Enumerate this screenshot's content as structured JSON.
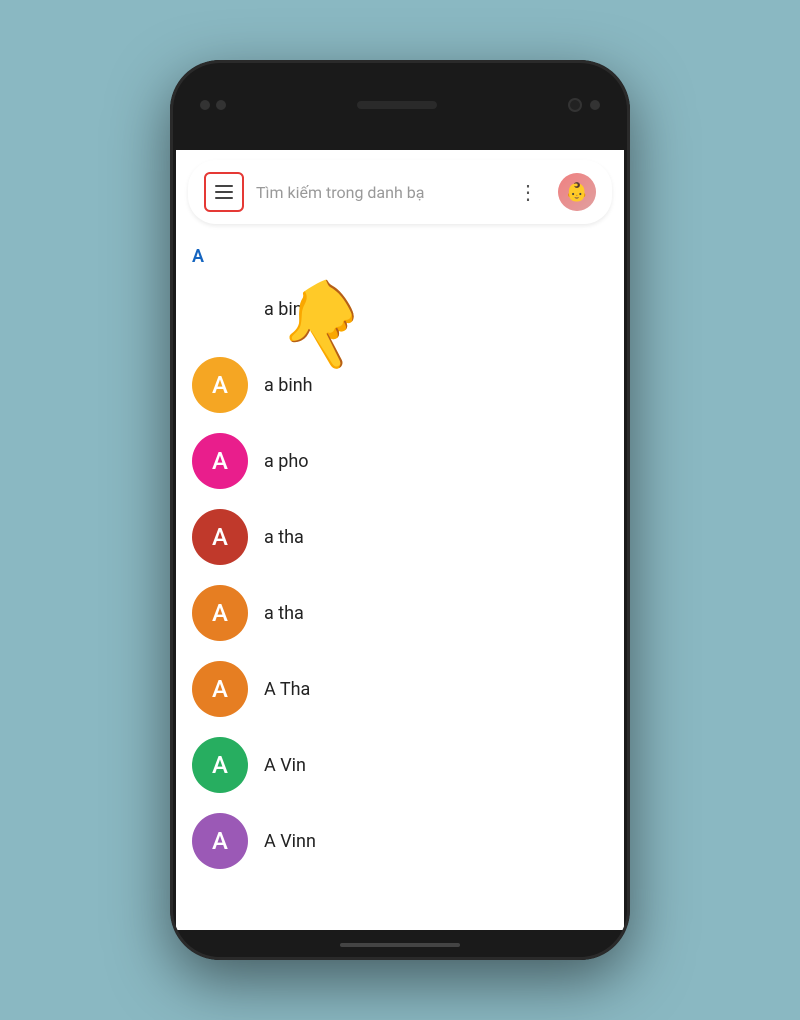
{
  "phone": {
    "background_color": "#8ab8c2"
  },
  "search_bar": {
    "placeholder": "Tìm kiếm trong danh bạ",
    "menu_label": "Menu",
    "more_options_label": "More options",
    "avatar_label": "User avatar"
  },
  "sections": [
    {
      "letter": "A",
      "contacts": [
        {
          "id": 1,
          "name": "a binh",
          "avatar_letter": "",
          "avatar_color": "transparent",
          "has_avatar": false
        },
        {
          "id": 2,
          "name": "a binh",
          "avatar_letter": "A",
          "avatar_color": "#f5a623",
          "has_avatar": true
        },
        {
          "id": 3,
          "name": "a pho",
          "avatar_letter": "A",
          "avatar_color": "#e91e8c",
          "has_avatar": true
        },
        {
          "id": 4,
          "name": "a tha",
          "avatar_letter": "A",
          "avatar_color": "#c0392b",
          "has_avatar": true
        },
        {
          "id": 5,
          "name": "a tha",
          "avatar_letter": "A",
          "avatar_color": "#e67e22",
          "has_avatar": true
        },
        {
          "id": 6,
          "name": "A Tha",
          "avatar_letter": "A",
          "avatar_color": "#e67e22",
          "has_avatar": true
        },
        {
          "id": 7,
          "name": "A Vin",
          "avatar_letter": "A",
          "avatar_color": "#27ae60",
          "has_avatar": true
        },
        {
          "id": 8,
          "name": "A Vinn",
          "avatar_letter": "A",
          "avatar_color": "#9b59b6",
          "has_avatar": true
        }
      ]
    }
  ],
  "icons": {
    "hamburger": "☰",
    "more_vert": "⋮",
    "hand_pointer": "👆"
  }
}
